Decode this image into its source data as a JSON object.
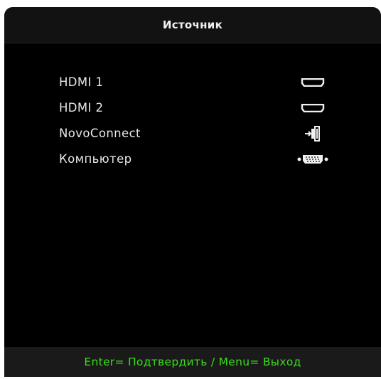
{
  "menu": {
    "title": "Источник"
  },
  "sources": [
    {
      "label": "HDMI 1",
      "icon": "hdmi-port-icon"
    },
    {
      "label": "HDMI 2",
      "icon": "hdmi-port-icon"
    },
    {
      "label": "NovoConnect",
      "icon": "novoconnect-input-icon"
    },
    {
      "label": "Компьютер",
      "icon": "vga-port-icon"
    }
  ],
  "footer": {
    "hint": "Enter= Подтвердить / Menu= Выход"
  },
  "colors": {
    "background": "#000000",
    "title_bar": "#121212",
    "footer_bar": "#1a1a1a",
    "text": "#e8e8e8",
    "footer_text": "#3ddc1f"
  }
}
